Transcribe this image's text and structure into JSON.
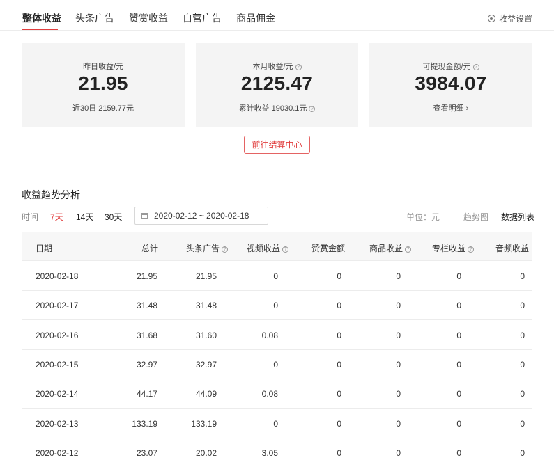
{
  "tabs": [
    {
      "label": "整体收益",
      "active": true
    },
    {
      "label": "头条广告",
      "active": false
    },
    {
      "label": "赞赏收益",
      "active": false
    },
    {
      "label": "自营广告",
      "active": false
    },
    {
      "label": "商品佣金",
      "active": false
    }
  ],
  "settings_label": "收益设置",
  "cards": {
    "yesterday": {
      "label": "昨日收益/元",
      "value": "21.95",
      "sub": "近30日 2159.77元"
    },
    "month": {
      "label": "本月收益/元",
      "value": "2125.47",
      "sub": "累计收益 19030.1元"
    },
    "withdrawable": {
      "label": "可提现金额/元",
      "value": "3984.07",
      "sub": "查看明细 ›"
    }
  },
  "settle_button": "前往结算中心",
  "trend": {
    "title": "收益趋势分析",
    "time_label": "时间",
    "ranges": [
      {
        "label": "7天",
        "active": true
      },
      {
        "label": "14天",
        "active": false
      },
      {
        "label": "30天",
        "active": false
      }
    ],
    "date_range": "2020-02-12  ~  2020-02-18",
    "unit": "单位：元",
    "view_chart": "趋势图",
    "view_table": "数据列表"
  },
  "table": {
    "headers": [
      "日期",
      "总计",
      "头条广告",
      "视频收益",
      "赞赏金额",
      "商品收益",
      "专栏收益",
      "音频收益"
    ],
    "rows": [
      [
        "2020-02-18",
        "21.95",
        "21.95",
        "0",
        "0",
        "0",
        "0",
        "0"
      ],
      [
        "2020-02-17",
        "31.48",
        "31.48",
        "0",
        "0",
        "0",
        "0",
        "0"
      ],
      [
        "2020-02-16",
        "31.68",
        "31.60",
        "0.08",
        "0",
        "0",
        "0",
        "0"
      ],
      [
        "2020-02-15",
        "32.97",
        "32.97",
        "0",
        "0",
        "0",
        "0",
        "0"
      ],
      [
        "2020-02-14",
        "44.17",
        "44.09",
        "0.08",
        "0",
        "0",
        "0",
        "0"
      ],
      [
        "2020-02-13",
        "133.19",
        "133.19",
        "0",
        "0",
        "0",
        "0",
        "0"
      ],
      [
        "2020-02-12",
        "23.07",
        "20.02",
        "3.05",
        "0",
        "0",
        "0",
        "0"
      ]
    ]
  },
  "colors": {
    "accent": "#e13d3d",
    "card_bg": "#f4f4f4",
    "header_bg": "#f7f7f7"
  }
}
